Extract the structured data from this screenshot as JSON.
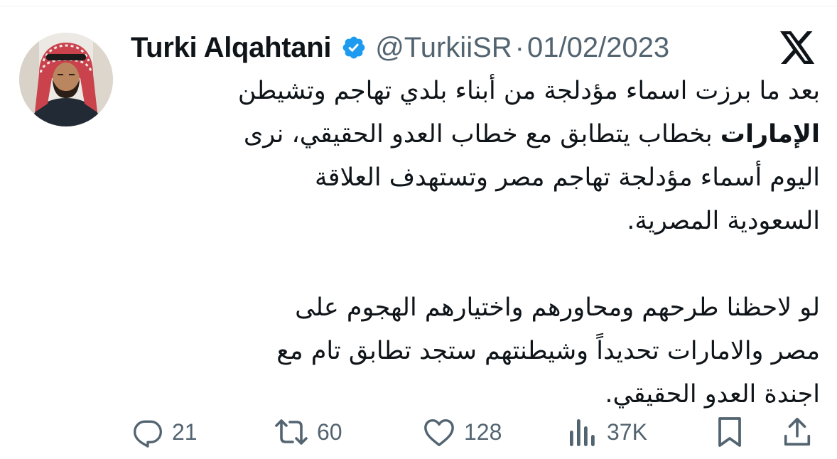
{
  "author": {
    "name": "Turki Alqahtani",
    "handle": "@TurkiiSR",
    "separator": "·",
    "date": "01/02/2023",
    "verified": true
  },
  "tweet": {
    "paragraph1": {
      "line1": "بعد ما برزت اسماء مؤدلجة من أبناء بلدي تهاجم وتشيطن",
      "line2_bold": "الإمارات",
      "line2_rest": " بخطاب يتطابق مع خطاب العدو الحقيقي، نرى",
      "line3": "اليوم أسماء مؤدلجة تهاجم مصر وتستهدف العلاقة",
      "line4": "السعودية المصرية."
    },
    "paragraph2": {
      "line1": "لو لاحظنا طرحهم ومحاورهم واختيارهم الهجوم على",
      "line2": "مصر والامارات تحديداً وشيطنتهم ستجد تطابق تام مع",
      "line3": "اجندة العدو الحقيقي."
    }
  },
  "actions": {
    "replies": "21",
    "retweets": "60",
    "likes": "128",
    "views": "37K"
  },
  "icons": {
    "verified": "verified-badge-icon",
    "platform": "x-logo-icon",
    "reply": "reply-icon",
    "retweet": "retweet-icon",
    "like": "heart-icon",
    "views": "views-icon",
    "bookmark": "bookmark-icon",
    "share": "share-icon"
  },
  "colors": {
    "text": "#0f1419",
    "secondary": "#536471",
    "verified": "#1d9bf0"
  }
}
